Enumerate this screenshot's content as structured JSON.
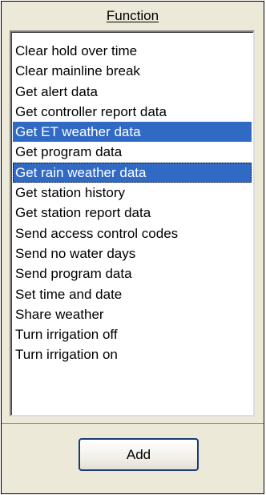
{
  "function_panel": {
    "header": "Function",
    "items": [
      {
        "label": "Clear hold over time",
        "selected": false
      },
      {
        "label": "Clear mainline break",
        "selected": false
      },
      {
        "label": "Get alert data",
        "selected": false
      },
      {
        "label": "Get controller report data",
        "selected": false
      },
      {
        "label": "Get ET weather data",
        "selected": true
      },
      {
        "label": "Get program data",
        "selected": false
      },
      {
        "label": "Get rain weather data",
        "selected": true,
        "focused": true
      },
      {
        "label": "Get station history",
        "selected": false
      },
      {
        "label": "Get station report data",
        "selected": false
      },
      {
        "label": "Send access control codes",
        "selected": false
      },
      {
        "label": "Send no water days",
        "selected": false
      },
      {
        "label": "Send program data",
        "selected": false
      },
      {
        "label": "Set time and date",
        "selected": false
      },
      {
        "label": "Share weather",
        "selected": false
      },
      {
        "label": "Turn irrigation off",
        "selected": false
      },
      {
        "label": "Turn irrigation on",
        "selected": false
      }
    ],
    "add_button_label": "Add"
  },
  "colors": {
    "panel_background": "#ece9d8",
    "selection_background": "#316ac5",
    "selection_text": "#ffffff",
    "button_border": "#1c3a74"
  }
}
